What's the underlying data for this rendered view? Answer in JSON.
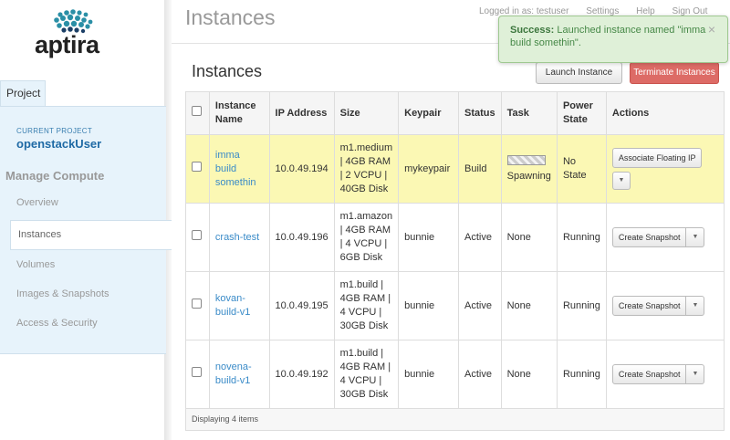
{
  "header": {
    "page_title": "Instances",
    "user_text": "Logged in as: testuser",
    "settings_label": "Settings",
    "help_label": "Help",
    "signout_label": "Sign Out"
  },
  "sidebar": {
    "logo_text": "aptira",
    "project_tab": "Project",
    "current_project_label": "CURRENT PROJECT",
    "current_project_name": "openstackUser",
    "manage_heading": "Manage Compute",
    "items": [
      {
        "label": "Overview"
      },
      {
        "label": "Instances"
      },
      {
        "label": "Volumes"
      },
      {
        "label": "Images & Snapshots"
      },
      {
        "label": "Access & Security"
      }
    ]
  },
  "toast": {
    "strong": "Success:",
    "message": "Launched instance named \"imma build somethin\".",
    "close": "×"
  },
  "main": {
    "section_title": "Instances",
    "launch_label": "Launch Instance",
    "terminate_label": "Terminate Instances",
    "columns": [
      "Instance Name",
      "IP Address",
      "Size",
      "Keypair",
      "Status",
      "Task",
      "Power State",
      "Actions"
    ],
    "rows": [
      {
        "name": "imma build somethin",
        "ip": "10.0.49.194",
        "size": "m1.medium | 4GB RAM | 2 VCPU | 40GB Disk",
        "keypair": "mykeypair",
        "status": "Build",
        "task": "Spawning",
        "power": "No State",
        "action": "Associate Floating IP"
      },
      {
        "name": "crash-test",
        "ip": "10.0.49.196",
        "size": "m1.amazon | 4GB RAM | 4 VCPU | 6GB Disk",
        "keypair": "bunnie",
        "status": "Active",
        "task": "None",
        "power": "Running",
        "action": "Create Snapshot"
      },
      {
        "name": "kovan-build-v1",
        "ip": "10.0.49.195",
        "size": "m1.build | 4GB RAM | 4 VCPU | 30GB Disk",
        "keypair": "bunnie",
        "status": "Active",
        "task": "None",
        "power": "Running",
        "action": "Create Snapshot"
      },
      {
        "name": "novena-build-v1",
        "ip": "10.0.49.192",
        "size": "m1.build | 4GB RAM | 4 VCPU | 30GB Disk",
        "keypair": "bunnie",
        "status": "Active",
        "task": "None",
        "power": "Running",
        "action": "Create Snapshot"
      }
    ],
    "footer": "Displaying 4 items"
  },
  "colors": {
    "accent": "#3a8bc8",
    "success_bg": "#dff0d8",
    "danger": "#dd6b66",
    "highlight_row": "#fbf8b4",
    "sidebar_bg": "#e7f3fb"
  }
}
